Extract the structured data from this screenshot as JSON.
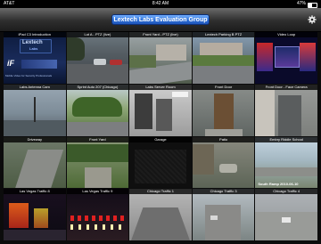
{
  "status_bar": {
    "carrier": "AT&T",
    "time": "8:42 AM",
    "battery": "47%",
    "battery_level": 0.47
  },
  "header": {
    "title": "Lextech Labs Evaluation Group",
    "settings_icon": "gear-icon"
  },
  "cameras": [
    {
      "name": "iPad C3 Introduction"
    },
    {
      "name": "Lot A - PTZ (live)"
    },
    {
      "name": "Front Yard - PTZ (live)"
    },
    {
      "name": "Lextech Parking B PTZ"
    },
    {
      "name": "Video Loop"
    },
    {
      "name": "Labs Antenna Cam"
    },
    {
      "name": "Sprint Auto 207 (Chicago)"
    },
    {
      "name": "Labs Server Room"
    },
    {
      "name": "Front Door"
    },
    {
      "name": "Front Door - Face Camera"
    },
    {
      "name": "Driveway"
    },
    {
      "name": "Front Yard"
    },
    {
      "name": "Garage"
    },
    {
      "name": "Patio"
    },
    {
      "name": "Embry Riddle School"
    },
    {
      "name": "Las Vegas Traffic 8"
    },
    {
      "name": "Las Vegas Traffic 9"
    },
    {
      "name": "Chicago Traffic 1"
    },
    {
      "name": "Chicago Traffic 3"
    },
    {
      "name": "Chicago Traffic 4"
    }
  ],
  "intro_tile": {
    "logo": "Lextech",
    "logo_sub": "Labs",
    "app_mark": "iF",
    "tagline": "Mobile Video for Security Professionals"
  },
  "embry_overlay": "South Ramp 2010-06-10",
  "colors": {
    "title_pill": "#2d70d8",
    "nav_bar": "#2e2e2e",
    "background": "#0c0c0c"
  }
}
